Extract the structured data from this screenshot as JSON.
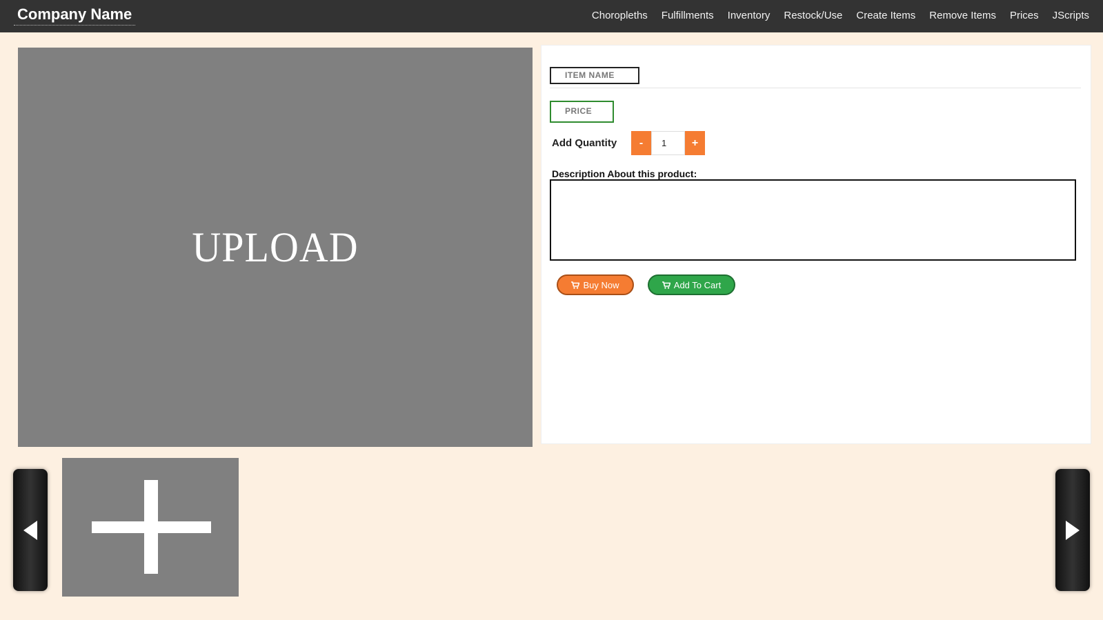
{
  "nav": {
    "brand": "Company Name",
    "links": [
      "Choropleths",
      "Fulfillments",
      "Inventory",
      "Restock/Use",
      "Create Items",
      "Remove Items",
      "Prices",
      "JScripts"
    ]
  },
  "upload": {
    "label": "UPLOAD"
  },
  "product": {
    "item_name": "ITEM NAME",
    "price": "PRICE",
    "quantity_label": "Add Quantity",
    "quantity_value": "1",
    "minus_label": "-",
    "plus_label": "+",
    "description_label": "Description About this product:",
    "description_value": ""
  },
  "actions": {
    "buy_now": "Buy Now",
    "add_to_cart": "Add To Cart"
  },
  "colors": {
    "nav_bg": "#333333",
    "page_bg": "#fdf0e1",
    "accent_orange": "#f57c32",
    "accent_green": "#2fa64a",
    "placeholder_gray": "#808080"
  },
  "icons": [
    "cart-icon",
    "chevron-left-icon",
    "chevron-right-icon",
    "plus-icon"
  ]
}
